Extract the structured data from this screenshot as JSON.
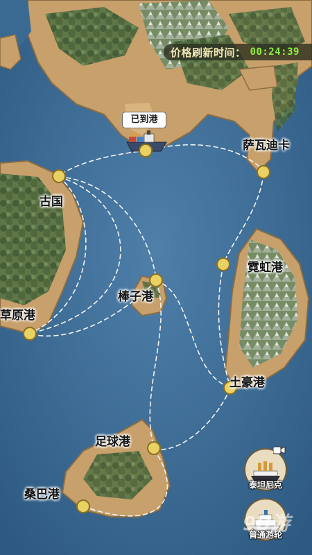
{
  "timer": {
    "label": "价格刷新时间：",
    "value": "00:24:39"
  },
  "status_tag": "已到港",
  "ports": {
    "sawadika": "萨瓦迪卡",
    "guguo": "古国",
    "nihong": "霓虹港",
    "bangzi": "棒子港",
    "caoyuan": "草原港",
    "tuhao": "土豪港",
    "zuqiu": "足球港",
    "sangba": "桑巴港"
  },
  "ships": {
    "titanic": "泰坦尼克",
    "cruise": "普通游轮"
  },
  "watermark": "9U游",
  "colors": {
    "sea": "#3f6f9a",
    "land": "#c8a06a",
    "forest": "#4f6a3c",
    "dot": "#ead163",
    "timer_value": "#8ef13d"
  }
}
